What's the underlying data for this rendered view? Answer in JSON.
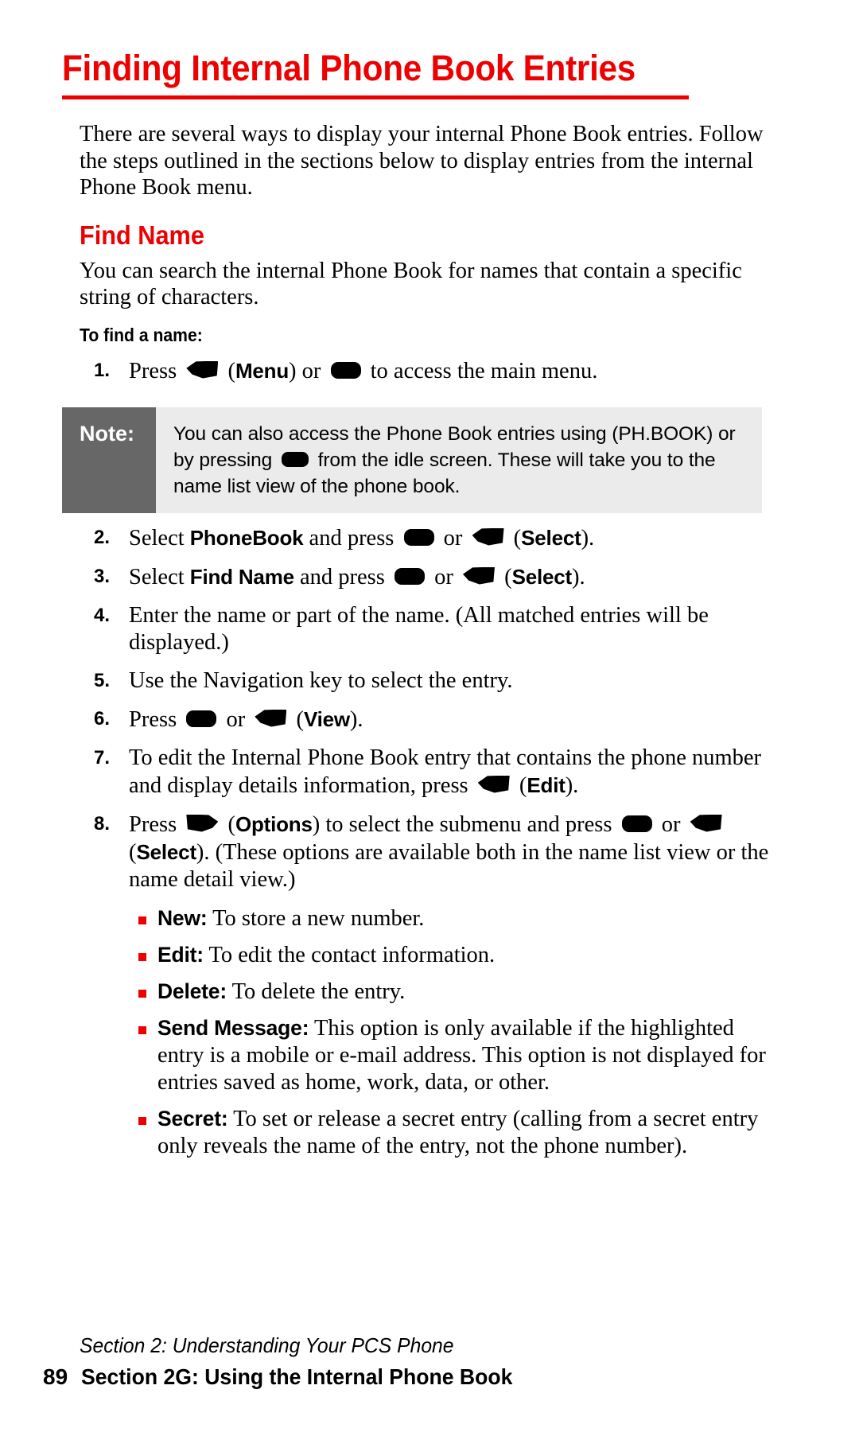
{
  "document": {
    "title": "Finding Internal Phone Book Entries",
    "accent_color": "#ee0000",
    "note_label_bg": "#676767",
    "note_body_bg": "#ebebeb"
  },
  "intro": {
    "paragraph": "There are several ways to display your internal Phone Book entries. Follow the steps outlined in the sections below to display entries from the internal Phone Book menu."
  },
  "find_name": {
    "heading": "Find Name",
    "paragraph": "You can search the internal Phone Book for names that contain a specific string of characters.",
    "subhead": "To find a name:"
  },
  "steps": [
    {
      "num": "1.",
      "parts": [
        {
          "t": "text",
          "v": "Press "
        },
        {
          "t": "icon",
          "v": "soft-key-left-icon"
        },
        {
          "t": "text",
          "v": " ("
        },
        {
          "t": "bold",
          "v": "Menu"
        },
        {
          "t": "text",
          "v": ") or "
        },
        {
          "t": "icon",
          "v": "ok-key-icon"
        },
        {
          "t": "text",
          "v": " to access the main menu."
        }
      ]
    },
    {
      "num": "2.",
      "parts": [
        {
          "t": "text",
          "v": "Select "
        },
        {
          "t": "bold",
          "v": "PhoneBook"
        },
        {
          "t": "text",
          "v": " and press "
        },
        {
          "t": "icon",
          "v": "ok-key-icon"
        },
        {
          "t": "text",
          "v": " or "
        },
        {
          "t": "icon",
          "v": "soft-key-left-icon"
        },
        {
          "t": "text",
          "v": " ("
        },
        {
          "t": "bold",
          "v": "Select"
        },
        {
          "t": "text",
          "v": ")."
        }
      ]
    },
    {
      "num": "3.",
      "parts": [
        {
          "t": "text",
          "v": "Select "
        },
        {
          "t": "bold",
          "v": "Find Name"
        },
        {
          "t": "text",
          "v": " and press "
        },
        {
          "t": "icon",
          "v": "ok-key-icon"
        },
        {
          "t": "text",
          "v": " or "
        },
        {
          "t": "icon",
          "v": "soft-key-left-icon"
        },
        {
          "t": "text",
          "v": " ("
        },
        {
          "t": "bold",
          "v": "Select"
        },
        {
          "t": "text",
          "v": ")."
        }
      ]
    },
    {
      "num": "4.",
      "parts": [
        {
          "t": "text",
          "v": "Enter the name or part of the name. (All matched entries will be displayed.)"
        }
      ]
    },
    {
      "num": "5.",
      "parts": [
        {
          "t": "text",
          "v": "Use the Navigation key to select the entry."
        }
      ]
    },
    {
      "num": "6.",
      "parts": [
        {
          "t": "text",
          "v": "Press "
        },
        {
          "t": "icon",
          "v": "ok-key-icon"
        },
        {
          "t": "text",
          "v": " or "
        },
        {
          "t": "icon",
          "v": "soft-key-left-icon"
        },
        {
          "t": "text",
          "v": " ("
        },
        {
          "t": "bold",
          "v": "View"
        },
        {
          "t": "text",
          "v": ")."
        }
      ]
    },
    {
      "num": "7.",
      "parts": [
        {
          "t": "text",
          "v": "To edit the Internal Phone Book entry that contains the phone number and display details information, press "
        },
        {
          "t": "icon",
          "v": "soft-key-left-icon"
        },
        {
          "t": "text",
          "v": " ("
        },
        {
          "t": "bold",
          "v": "Edit"
        },
        {
          "t": "text",
          "v": ")."
        }
      ]
    },
    {
      "num": "8.",
      "parts": [
        {
          "t": "text",
          "v": "Press "
        },
        {
          "t": "icon",
          "v": "soft-key-right-icon"
        },
        {
          "t": "text",
          "v": " ("
        },
        {
          "t": "bold",
          "v": "Options"
        },
        {
          "t": "text",
          "v": ") to select the submenu and press "
        },
        {
          "t": "icon",
          "v": "ok-key-icon"
        },
        {
          "t": "text",
          "v": " or "
        },
        {
          "t": "icon",
          "v": "soft-key-left-icon"
        },
        {
          "t": "text",
          "v": " ("
        },
        {
          "t": "bold",
          "v": "Select"
        },
        {
          "t": "text",
          "v": "). (These options are available both in the name list view or the name detail view.)"
        }
      ]
    }
  ],
  "note": {
    "label": "Note:",
    "line1_before": "You can also access the Phone Book entries using (PH.BOOK) or by pressing ",
    "icon": "ok-key-icon",
    "line1_after": " from the idle screen. These will take you to the name list view of the phone book."
  },
  "options": [
    {
      "label": "New:",
      "text": " To store a new number."
    },
    {
      "label": "Edit:",
      "text": " To edit the contact information."
    },
    {
      "label": "Delete:",
      "text": " To delete the entry."
    },
    {
      "label": "Send Message:",
      "text": " This option is only available if the highlighted entry is a mobile or e-mail address. This option is not displayed for entries saved as home, work, data, or other."
    },
    {
      "label": "Secret:",
      "text": " To set or release a secret entry (calling from a secret entry only reveals the name of the entry, not the phone number)."
    }
  ],
  "footer": {
    "section_line": "Section 2: Understanding Your PCS Phone",
    "page_number": "89",
    "section_title": "Section 2G: Using the Internal Phone Book"
  }
}
